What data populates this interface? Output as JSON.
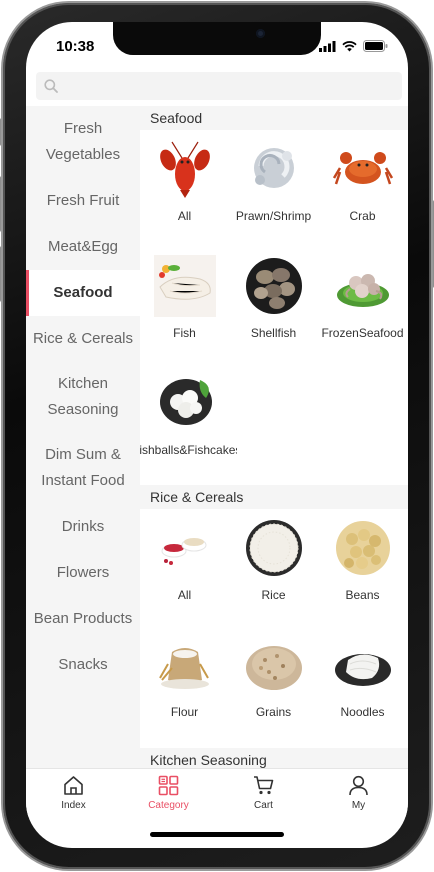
{
  "status_bar": {
    "time": "10:38"
  },
  "search": {
    "icon": "search-icon"
  },
  "sidebar": {
    "items": [
      {
        "label": "Fresh Vegetables",
        "active": false
      },
      {
        "label": "Fresh Fruit",
        "active": false
      },
      {
        "label": "Meat&Egg",
        "active": false
      },
      {
        "label": "Seafood",
        "active": true
      },
      {
        "label": "Rice & Cereals",
        "active": false
      },
      {
        "label": "Kitchen Seasoning",
        "active": false
      },
      {
        "label": "Dim Sum & Instant Food",
        "active": false
      },
      {
        "label": "Drinks",
        "active": false
      },
      {
        "label": "Flowers",
        "active": false
      },
      {
        "label": "Bean Products",
        "active": false
      },
      {
        "label": "Snacks",
        "active": false
      }
    ]
  },
  "sections": [
    {
      "title": "Seafood",
      "items": [
        {
          "label": "All",
          "icon": "lobster"
        },
        {
          "label": "Prawn/Shrimp",
          "icon": "shrimp"
        },
        {
          "label": "Crab",
          "icon": "crab"
        },
        {
          "label": "Fish",
          "icon": "fish-fillet"
        },
        {
          "label": "Shellfish",
          "icon": "clams"
        },
        {
          "label": "FrozenSeafood",
          "icon": "octopus"
        },
        {
          "label": "Fishballs&Fishcakes",
          "icon": "fishballs"
        }
      ]
    },
    {
      "title": "Rice & Cereals",
      "items": [
        {
          "label": "All",
          "icon": "grains-bowls"
        },
        {
          "label": "Rice",
          "icon": "rice-plate"
        },
        {
          "label": "Beans",
          "icon": "soybeans"
        },
        {
          "label": "Flour",
          "icon": "flour-sack"
        },
        {
          "label": "Grains",
          "icon": "grains-pile"
        },
        {
          "label": "Noodles",
          "icon": "noodles"
        }
      ]
    },
    {
      "title": "Kitchen Seasoning",
      "items": []
    }
  ],
  "tabbar": {
    "items": [
      {
        "label": "Index",
        "icon": "home-icon",
        "active": false
      },
      {
        "label": "Category",
        "icon": "grid-icon",
        "active": true
      },
      {
        "label": "Cart",
        "icon": "cart-icon",
        "active": false
      },
      {
        "label": "My",
        "icon": "user-icon",
        "active": false
      }
    ]
  },
  "colors": {
    "accent": "#e94f64",
    "sidebar_bg": "#f5f5f5"
  }
}
